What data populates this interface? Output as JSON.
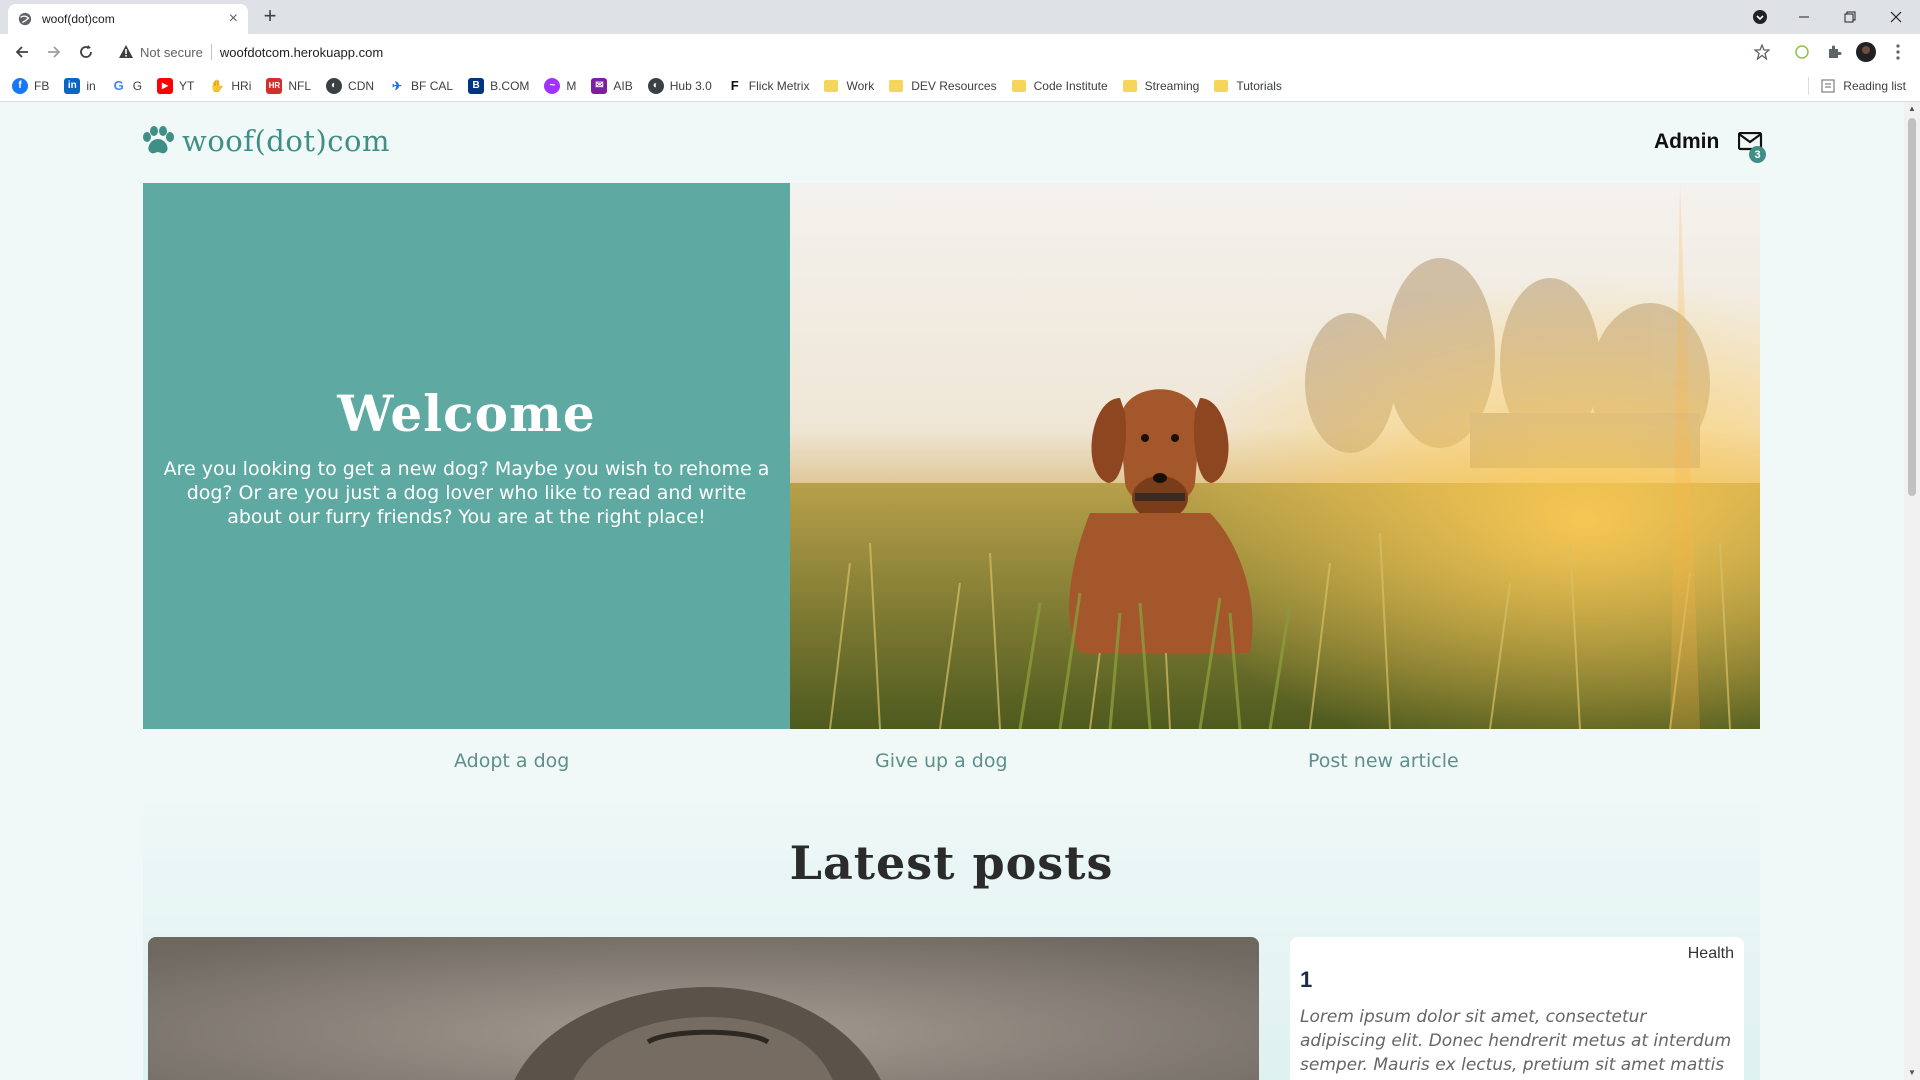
{
  "browser": {
    "tab_title": "woof(dot)com",
    "tab_close": "×",
    "new_tab": "+",
    "security_label": "Not secure",
    "url": "woofdotcom.herokuapp.com",
    "bookmarks": [
      {
        "label": "FB",
        "icon": "facebook-icon",
        "color": "#1877f2"
      },
      {
        "label": "in",
        "icon": "linkedin-icon",
        "color": "#0a66c2"
      },
      {
        "label": "G",
        "icon": "google-icon",
        "color": "#4285f4"
      },
      {
        "label": "YT",
        "icon": "youtube-icon",
        "color": "#ff0000"
      },
      {
        "label": "HRi",
        "icon": "hri-icon",
        "color": "#3c4043"
      },
      {
        "label": "NFL",
        "icon": "nfl-icon",
        "color": "#d32f2f"
      },
      {
        "label": "CDN",
        "icon": "globe-icon",
        "color": "#3c4043"
      },
      {
        "label": "BF CAL",
        "icon": "bfcal-icon",
        "color": "#1a73e8"
      },
      {
        "label": "B.COM",
        "icon": "booking-icon",
        "color": "#003580"
      },
      {
        "label": "M",
        "icon": "messenger-icon",
        "color": "#a033ff"
      },
      {
        "label": "AIB",
        "icon": "aib-icon",
        "color": "#7b1fa2"
      },
      {
        "label": "Hub 3.0",
        "icon": "globe-icon",
        "color": "#3c4043"
      },
      {
        "label": "Flick Metrix",
        "icon": "flickmetrix-icon",
        "color": "#111111"
      }
    ],
    "folders": [
      "Work",
      "DEV Resources",
      "Code Institute",
      "Streaming",
      "Tutorials"
    ],
    "reading_list": "Reading list"
  },
  "site": {
    "logo_text": "woof(dot)com",
    "admin_label": "Admin",
    "message_count": "3",
    "accent_color": "#5fa9a3"
  },
  "hero": {
    "title": "Welcome",
    "text": "Are you looking to get a new dog? Maybe you wish to rehome a dog? Or are you just a dog lover who like to read and write about our furry friends? You are at the right place!"
  },
  "quick_links": [
    "Adopt a dog",
    "Give up a dog",
    "Post new article"
  ],
  "latest": {
    "heading": "Latest posts",
    "post": {
      "category": "Health",
      "title": "1",
      "excerpt": "Lorem ipsum dolor sit amet, consectetur adipiscing elit. Donec hendrerit metus at interdum semper. Mauris ex lectus, pretium sit amet mattis"
    }
  }
}
